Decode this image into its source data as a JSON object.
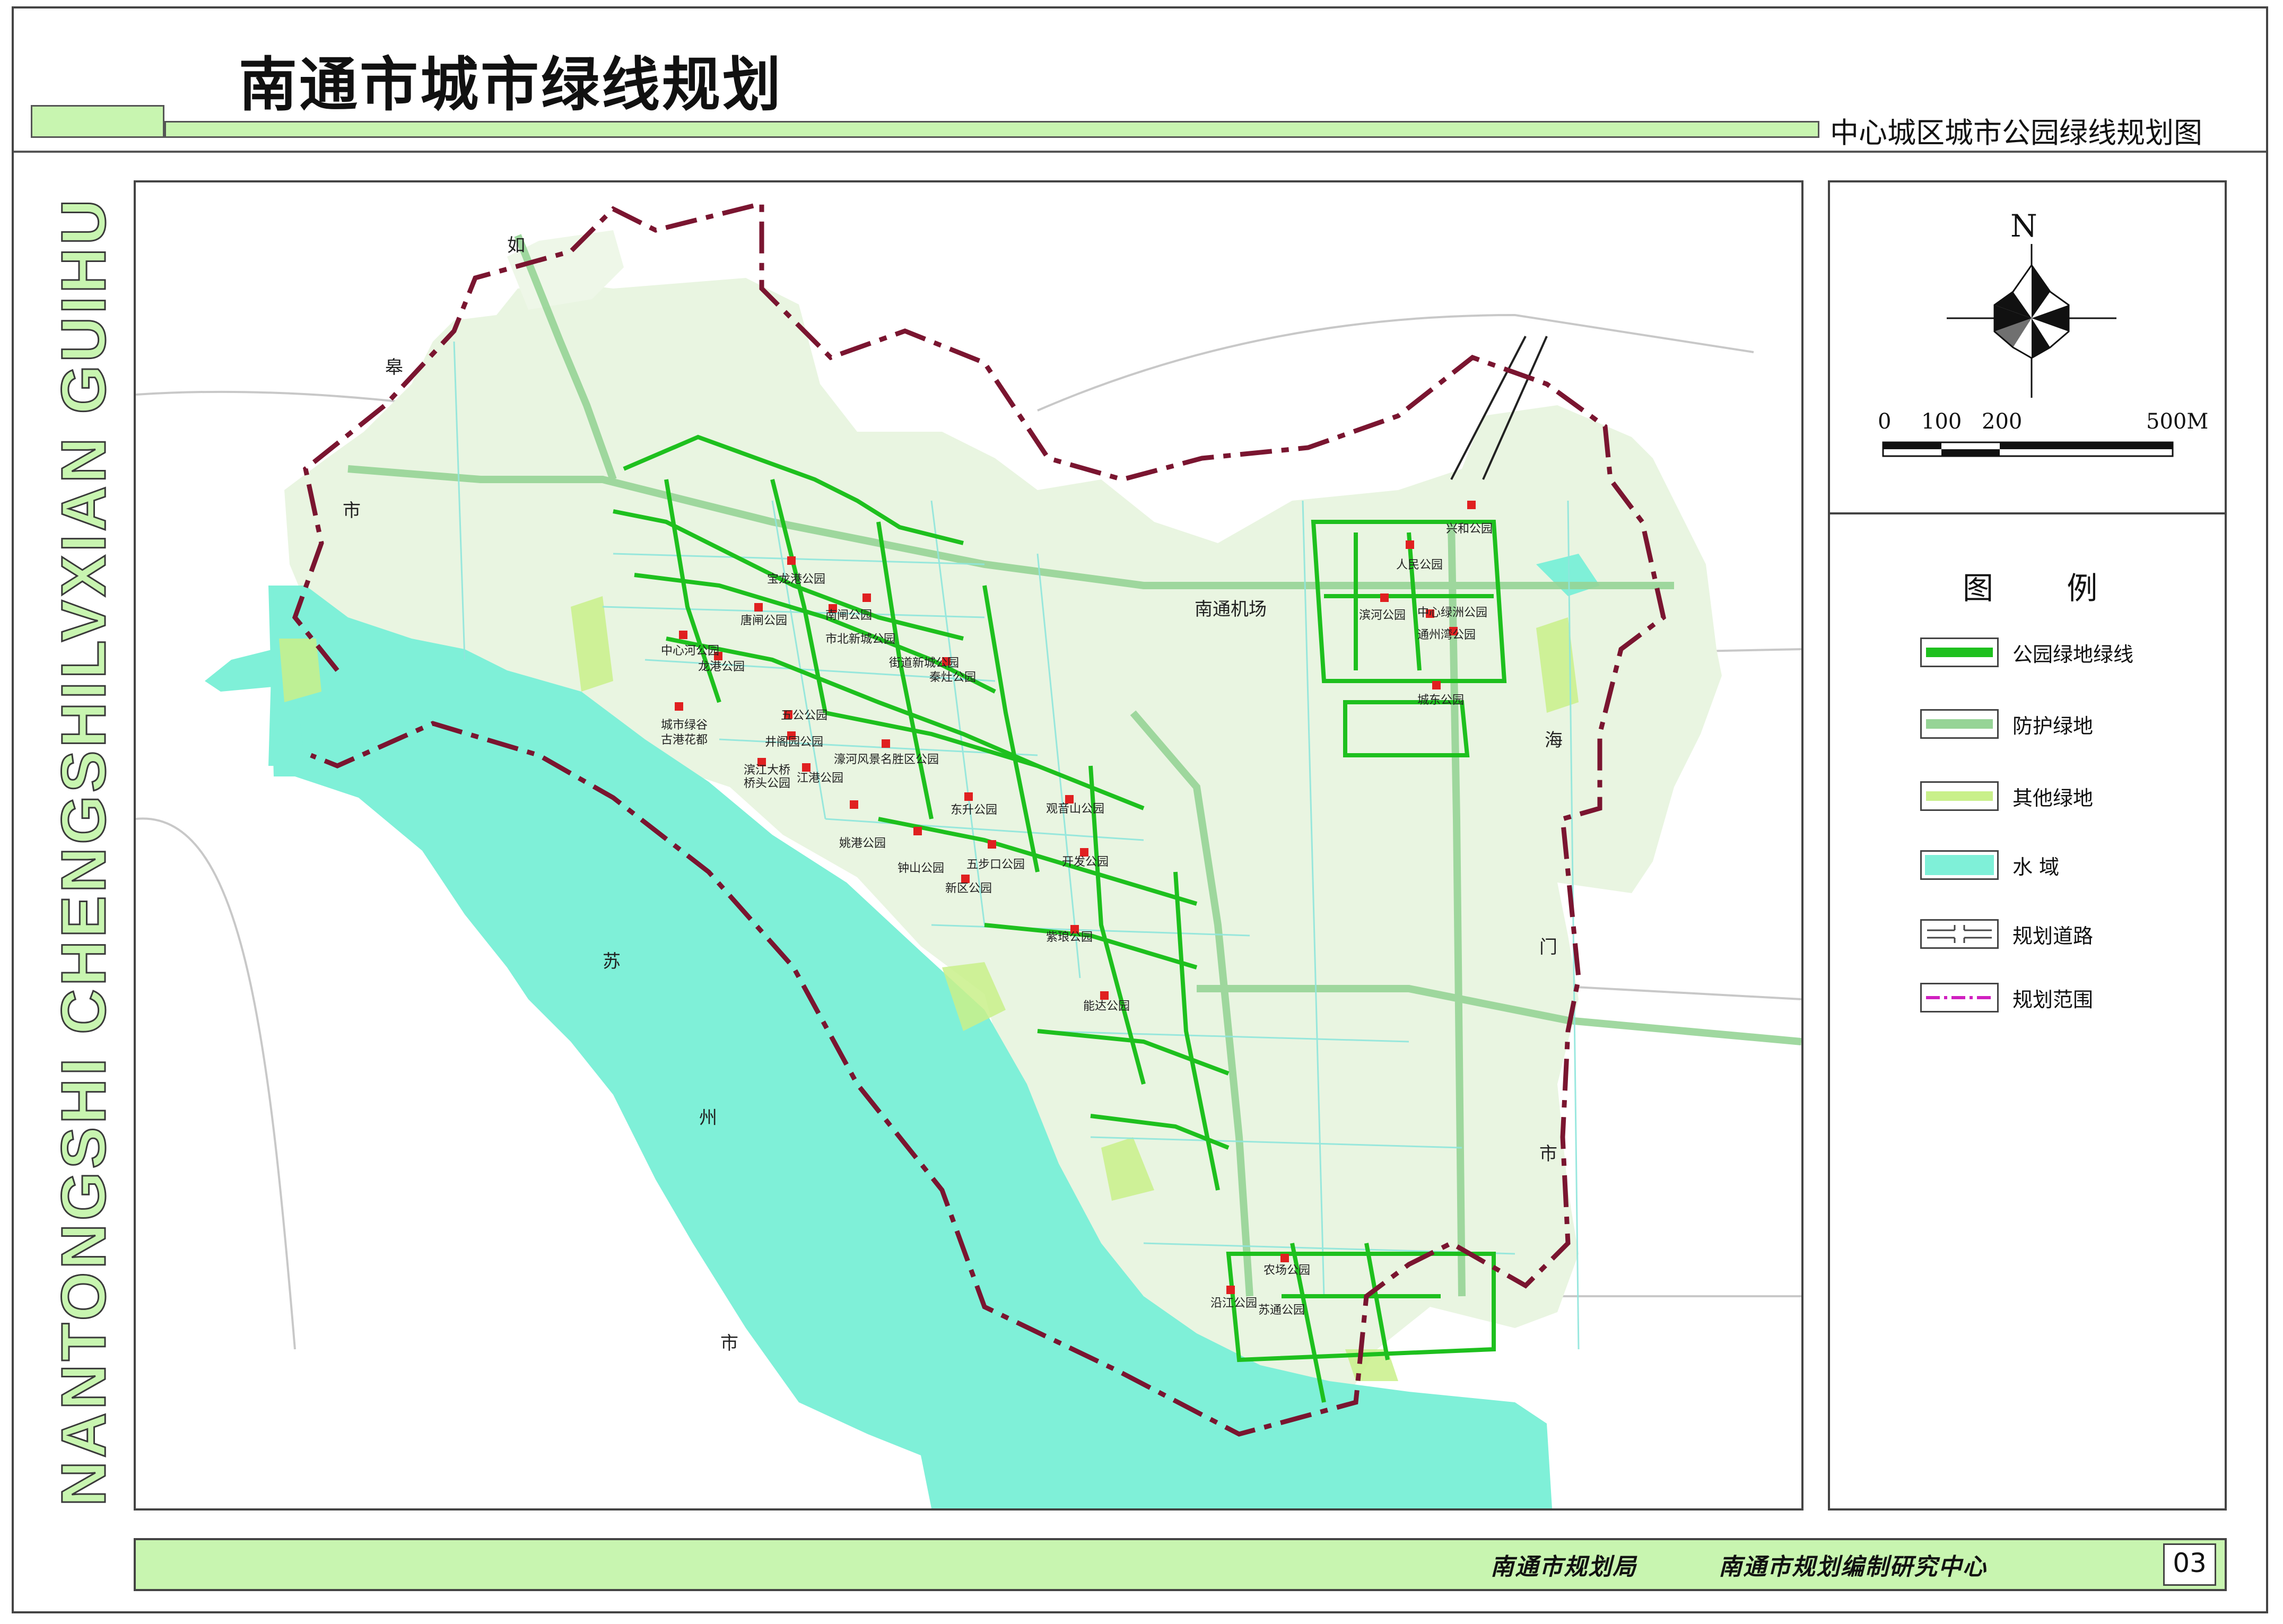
{
  "header": {
    "title": "南通市城市绿线规划",
    "subtitle": "中心城区城市公园绿线规划图"
  },
  "side_text": "NANTONGSHI CHENGSHILVXIAN GUIHUA",
  "map": {
    "region_labels": [
      "如",
      "皋",
      "市",
      "苏",
      "州",
      "市",
      "海",
      "门",
      "市"
    ],
    "airport_label": "南通机场",
    "parks": [
      "宝龙港公园",
      "唐闸公园",
      "南闸公园",
      "市北新城公园",
      "街道新城公园",
      "中心河公园",
      "龙港公园",
      "城市绿谷",
      "古港花都",
      "五公公园",
      "井阁园公园",
      "濠河风景名胜区公园",
      "滨江大桥",
      "桥头公园",
      "江港公园",
      "秦灶公园",
      "东升公园",
      "观音山公园",
      "姚港公园",
      "钟山公园",
      "五步口公园",
      "新区公园",
      "开发公园",
      "紫琅公园",
      "能达公园",
      "农场公园",
      "沿江公园",
      "苏通公园",
      "兴和公园",
      "人民公园",
      "滨河公园",
      "中心绿洲公园",
      "通州湾公园",
      "城东公园"
    ],
    "colors": {
      "water": "#7ff0d8",
      "urban_land": "#e9f5e1",
      "park_line": "#1ec01e",
      "protection_green": "#96d496",
      "other_green": "#c9f08a",
      "boundary": "#7a1530",
      "road": "#8fe6dc",
      "park_marker": "#e02020"
    }
  },
  "compass": {
    "north_label": "N"
  },
  "scale_bar": {
    "labels": [
      "0",
      "100",
      "200",
      "500M"
    ]
  },
  "legend": {
    "title": "图  例",
    "items": [
      {
        "label": "公园绿地绿线",
        "icon": "park-green-line-swatch"
      },
      {
        "label": "防护绿地",
        "icon": "protection-green-swatch"
      },
      {
        "label": "其他绿地",
        "icon": "other-green-swatch"
      },
      {
        "label": "水  域",
        "icon": "water-swatch"
      },
      {
        "label": "规划道路",
        "icon": "planned-road-swatch"
      },
      {
        "label": "规划范围",
        "icon": "planning-boundary-swatch"
      }
    ]
  },
  "footer": {
    "org1": "南通市规划局",
    "org2": "南通市规划编制研究中心",
    "page_number": "03"
  }
}
